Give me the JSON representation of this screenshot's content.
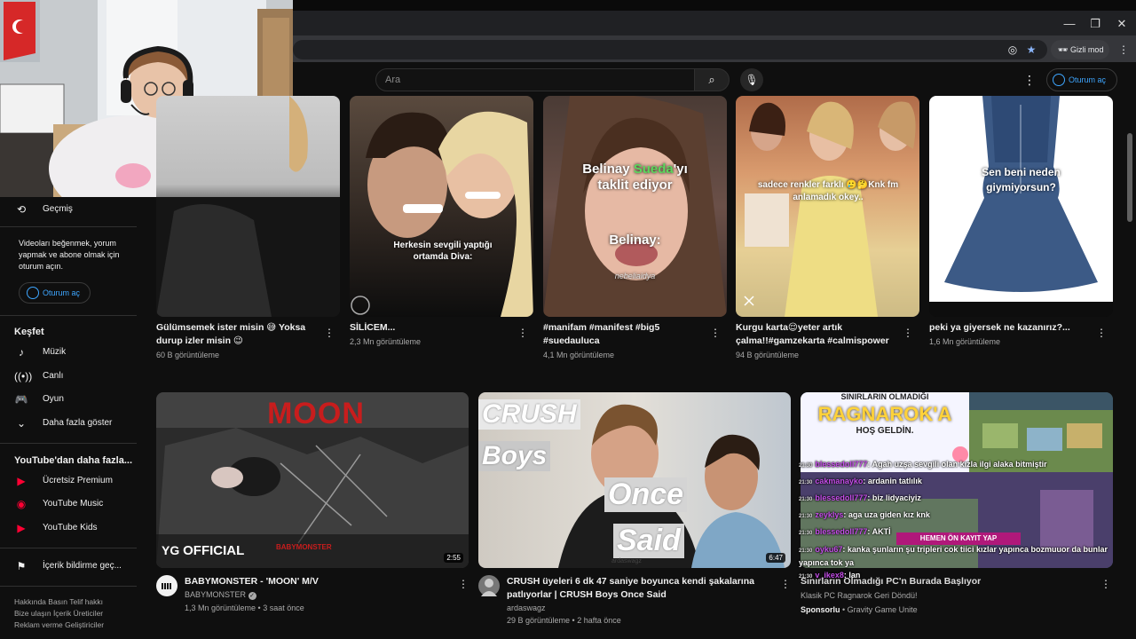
{
  "browser": {
    "incognito_label": "Gizli mod",
    "minimize": "—",
    "restore": "❐",
    "close": "✕"
  },
  "header": {
    "search_placeholder": "Ara",
    "signin_label": "Oturum aç"
  },
  "sidebar": {
    "history": "Geçmiş",
    "signin_prompt": "Videoları beğenmek, yorum yapmak ve abone olmak için oturum açın.",
    "signin_button": "Oturum aç",
    "explore_title": "Keşfet",
    "explore_items": [
      "Müzik",
      "Canlı",
      "Oyun",
      "Daha fazla göster"
    ],
    "more_title": "YouTube'dan daha fazla...",
    "more_items": [
      "Ücretsiz Premium",
      "YouTube Music",
      "YouTube Kids"
    ],
    "report": "İçerik bildirme geç...",
    "footer_line1": "Hakkında  Basın  Telif hakkı",
    "footer_line2": "Bize ulaşın  İçerik Üreticiler",
    "footer_line3": "Reklam verme  Geliştiriciler"
  },
  "shorts": [
    {
      "title": "Gülümsemek ister misin 😅 Yoksa durup izler misin 😉",
      "views": "60 B görüntüleme",
      "overlay": ""
    },
    {
      "title": "SİLİCEM...",
      "views": "2,3 Mn görüntüleme",
      "overlay": "Herkesin sevgili yaptığı ortamda Diva:"
    },
    {
      "title": "#manifam #manifest #big5 #suedauluca",
      "views": "4,1 Mn görüntüleme",
      "overlay_a": "Belinay",
      "overlay_b": "Sueda",
      "overlay_c": "'yı",
      "overlay_d": "taklit ediyor",
      "overlay_e": "Belinay:",
      "watermark": "nebeliaidya"
    },
    {
      "title": "Kurgu karta😌yeter artık çalma!!#gamzekarta #calmispower ...",
      "views": "94 B görüntüleme",
      "overlay": "sadece renkler farklı 🥲🤔Knk fm anlamadık okey.."
    },
    {
      "title": "peki ya giyersek ne kazanırız?...",
      "views": "1,6 Mn görüntüleme",
      "overlay": "Sen beni neden giymiyorsun?"
    }
  ],
  "videos": [
    {
      "title": "BABYMONSTER - 'MOON' M/V",
      "channel": "BABYMONSTER",
      "meta": "1,3 Mn görüntüleme • 3 saat önce",
      "duration": "2:55",
      "thumb_title": "MOON",
      "thumb_brand": "OFFICIAL",
      "thumb_sub": "BABYMONSTER"
    },
    {
      "title": "CRUSH üyeleri 6 dk 47 saniye boyunca kendi şakalarına patlıyorlar | CRUSH Boys Once Said",
      "channel": "ardaswagz",
      "meta": "29 B görüntüleme • 2 hafta önce",
      "duration": "6:47",
      "thumb_a": "CRUSH",
      "thumb_b": "Boys",
      "thumb_c": "Once",
      "thumb_d": "Said",
      "thumb_wm": "ardaswagz"
    },
    {
      "title": "Sınırların Olmadığı PC'n Burada Başlıyor",
      "channel_line1": "Klasik PC Ragnarok Geri Döndü!",
      "sponsor": "Sponsorlu",
      "advertiser": "• Gravity Game Unite",
      "thumb_a": "SINIRLARIN OLMADIĞI",
      "thumb_b": "RAGNAROK'A",
      "thumb_c": "HOŞ GELDİN.",
      "thumb_btn": "HEMEN ÖN KAYIT YAP"
    }
  ],
  "chat": [
    {
      "time": "21:30",
      "user": "blessedoll777",
      "msg": ": Agah uzşa sevgili olan kızla ilgi alaka bitmiştir"
    },
    {
      "time": "21:30",
      "user": "cakmanayko",
      "msg": ": ardanin tatlılık"
    },
    {
      "time": "21:30",
      "user": "blessedoll777",
      "msg": ": biz lidyaciyiz"
    },
    {
      "time": "21:30",
      "user": "zeyklys",
      "msg": ": aga uza giden kız knk"
    },
    {
      "time": "21:30",
      "user": "blessedoll777",
      "msg": ": AKTİ"
    },
    {
      "time": "21:30",
      "user": "oyku67",
      "msg": ": kanka şunların şu tripleri cok tiici kızlar yapınca bozmuuor da bunlar yapınca tok ya"
    },
    {
      "time": "21:30",
      "user": "v_ikex8",
      "msg": ": lan"
    }
  ],
  "colors": {
    "accent_blue": "#3ea6ff",
    "youtube_red": "#ff0033",
    "background": "#0f0f0f"
  }
}
